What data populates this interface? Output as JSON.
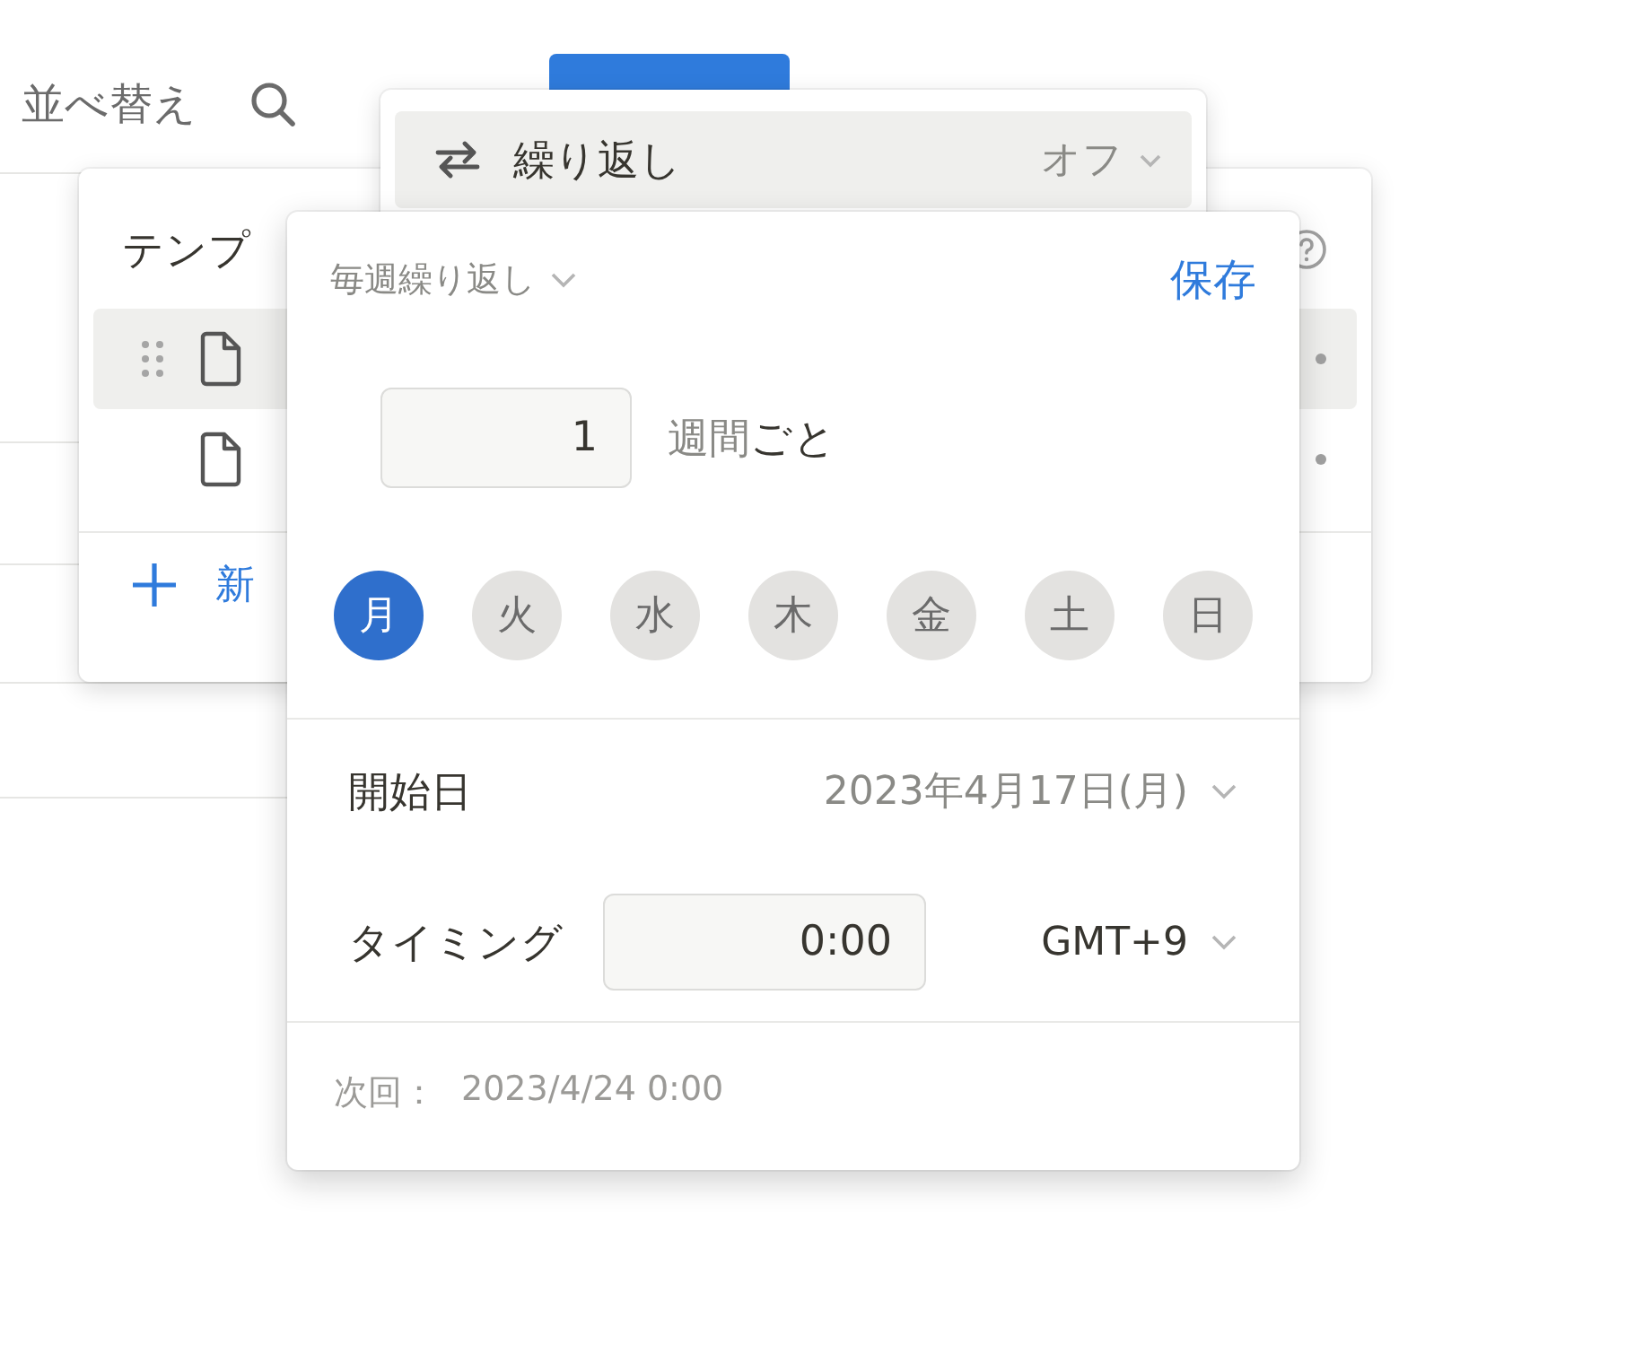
{
  "toolbar": {
    "sort_label": "並べ替え"
  },
  "template_panel": {
    "title": "テンプ",
    "rows": [
      {
        "selected": true
      },
      {
        "selected": false
      }
    ],
    "add_label": "新"
  },
  "repeat_menu": {
    "label": "繰り返し",
    "value": "オフ"
  },
  "repeat_popup": {
    "frequency": "毎週繰り返し",
    "save": "保存",
    "interval": "1",
    "unit": "週間",
    "unit_suffix": "ごと",
    "weekdays": [
      {
        "label": "月",
        "selected": true
      },
      {
        "label": "火",
        "selected": false
      },
      {
        "label": "水",
        "selected": false
      },
      {
        "label": "木",
        "selected": false
      },
      {
        "label": "金",
        "selected": false
      },
      {
        "label": "土",
        "selected": false
      },
      {
        "label": "日",
        "selected": false
      }
    ],
    "start_label": "開始日",
    "start_value": "2023年4月17日(月)",
    "timing_label": "タイミング",
    "time": "0:00",
    "timezone": "GMT+9",
    "next_label": "次回：",
    "next_value": "2023/4/24 0:00"
  }
}
